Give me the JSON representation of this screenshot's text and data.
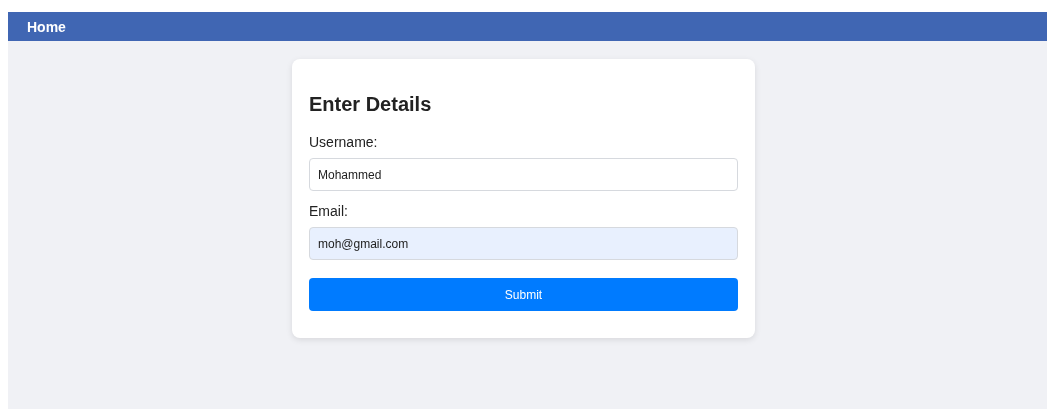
{
  "navbar": {
    "home_link": "Home"
  },
  "form": {
    "title": "Enter Details",
    "fields": [
      {
        "label": "Username:",
        "value": "Mohammed",
        "autofilled": false
      },
      {
        "label": "Email:",
        "value": "moh@gmail.com",
        "autofilled": true
      }
    ],
    "submit": "Submit"
  }
}
